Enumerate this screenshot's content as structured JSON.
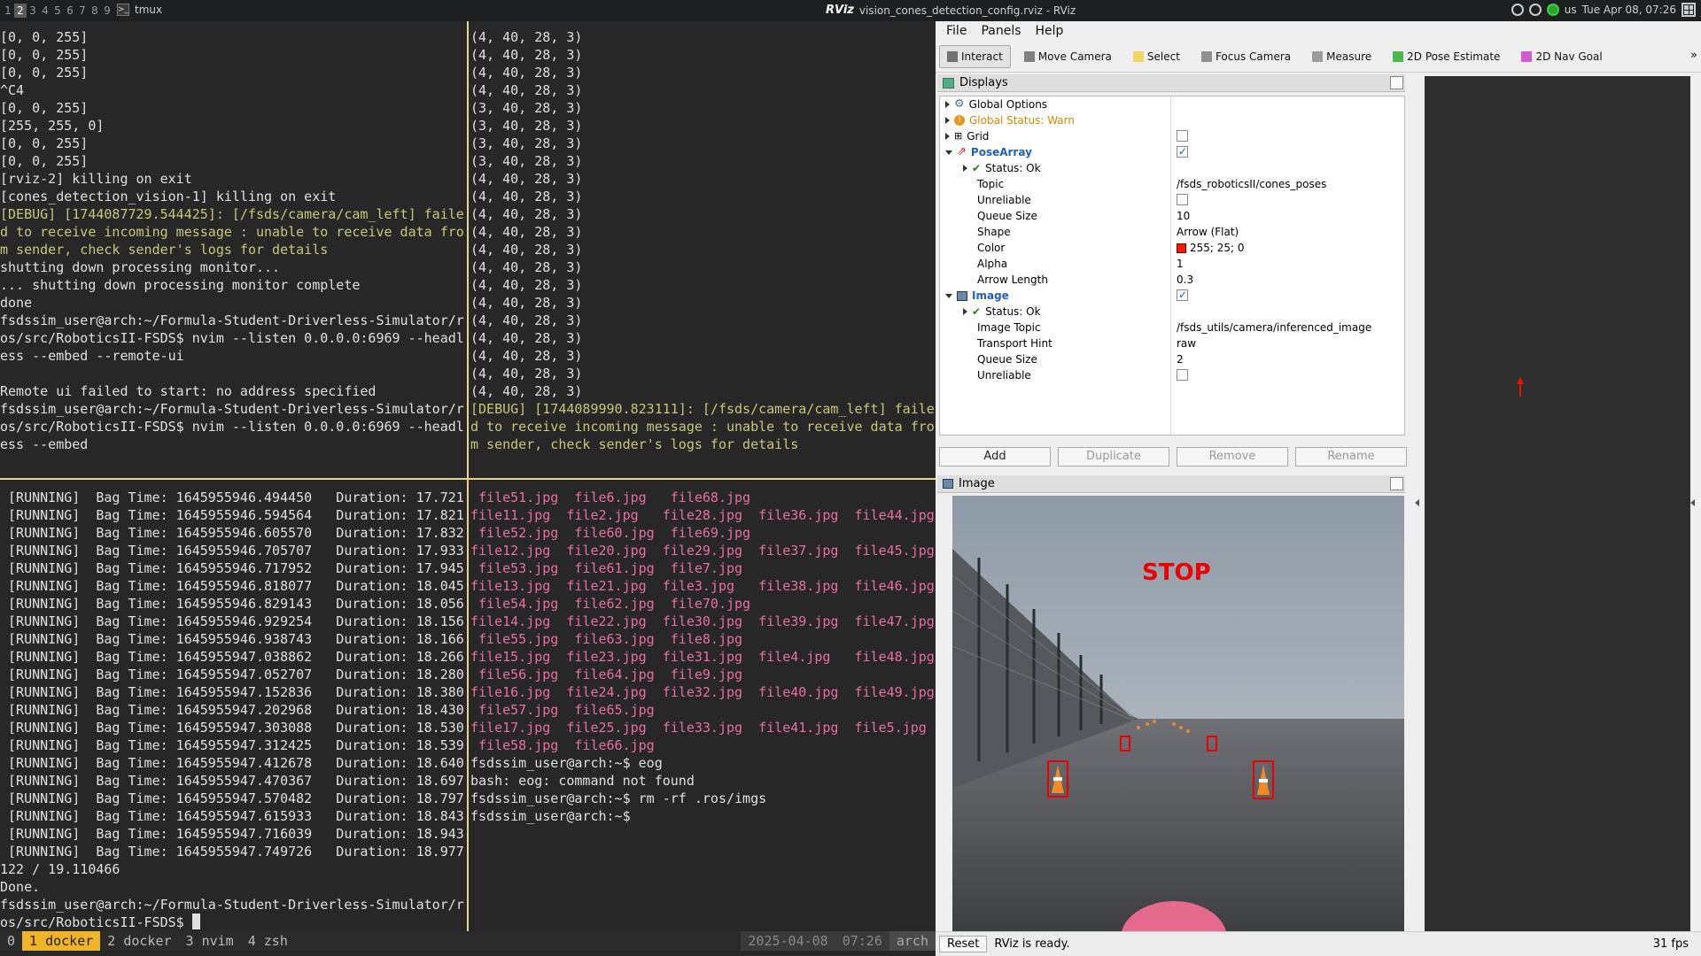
{
  "topbar": {
    "workspaces": [
      "1",
      "2",
      "3",
      "4",
      "5",
      "6",
      "7",
      "8",
      "9"
    ],
    "active_workspace": "2",
    "tmux_title": "tmux",
    "rviz_logo": "RViz",
    "rviz_title": "vision_cones_detection_config.rviz - RViz",
    "keyboard": "us",
    "clock": "Tue Apr 08, 07:26"
  },
  "pane_top_left": {
    "lines": [
      {
        "t": "[0, 0, 255]",
        "c": ""
      },
      {
        "t": "[0, 0, 255]",
        "c": ""
      },
      {
        "t": "[0, 0, 255]",
        "c": ""
      },
      {
        "t": "^C4",
        "c": ""
      },
      {
        "t": "[0, 0, 255]",
        "c": ""
      },
      {
        "t": "[255, 255, 0]",
        "c": ""
      },
      {
        "t": "[0, 0, 255]",
        "c": ""
      },
      {
        "t": "[0, 0, 255]",
        "c": ""
      },
      {
        "t": "[rviz-2] killing on exit",
        "c": ""
      },
      {
        "t": "[cones_detection_vision-1] killing on exit",
        "c": ""
      },
      {
        "t": "[DEBUG] [1744087729.544425]: [/fsds/camera/cam_left] faile",
        "c": "dbg"
      },
      {
        "t": "d to receive incoming message : unable to receive data fro",
        "c": "dbg"
      },
      {
        "t": "m sender, check sender's logs for details",
        "c": "dbg"
      },
      {
        "t": "shutting down processing monitor...",
        "c": ""
      },
      {
        "t": "... shutting down processing monitor complete",
        "c": ""
      },
      {
        "t": "done",
        "c": ""
      },
      {
        "t": "fsdssim_user@arch:~/Formula-Student-Driverless-Simulator/r",
        "c": ""
      },
      {
        "t": "os/src/RoboticsII-FSDS$ nvim --listen 0.0.0.0:6969 --headl",
        "c": ""
      },
      {
        "t": "ess --embed --remote-ui",
        "c": ""
      },
      {
        "t": "",
        "c": ""
      },
      {
        "t": "Remote ui failed to start: no address specified",
        "c": ""
      },
      {
        "t": "fsdssim_user@arch:~/Formula-Student-Driverless-Simulator/r",
        "c": ""
      },
      {
        "t": "os/src/RoboticsII-FSDS$ nvim --listen 0.0.0.0:6969 --headl",
        "c": ""
      },
      {
        "t": "ess --embed",
        "c": ""
      }
    ]
  },
  "pane_top_right": {
    "lines": [
      {
        "t": "(4, 40, 28, 3)",
        "c": ""
      },
      {
        "t": "(4, 40, 28, 3)",
        "c": ""
      },
      {
        "t": "(4, 40, 28, 3)",
        "c": ""
      },
      {
        "t": "(4, 40, 28, 3)",
        "c": ""
      },
      {
        "t": "(3, 40, 28, 3)",
        "c": ""
      },
      {
        "t": "(3, 40, 28, 3)",
        "c": ""
      },
      {
        "t": "(3, 40, 28, 3)",
        "c": ""
      },
      {
        "t": "(3, 40, 28, 3)",
        "c": ""
      },
      {
        "t": "(4, 40, 28, 3)",
        "c": ""
      },
      {
        "t": "(4, 40, 28, 3)",
        "c": ""
      },
      {
        "t": "(4, 40, 28, 3)",
        "c": ""
      },
      {
        "t": "(4, 40, 28, 3)",
        "c": ""
      },
      {
        "t": "(4, 40, 28, 3)",
        "c": ""
      },
      {
        "t": "(4, 40, 28, 3)",
        "c": ""
      },
      {
        "t": "(4, 40, 28, 3)",
        "c": ""
      },
      {
        "t": "(4, 40, 28, 3)",
        "c": ""
      },
      {
        "t": "(4, 40, 28, 3)",
        "c": ""
      },
      {
        "t": "(4, 40, 28, 3)",
        "c": ""
      },
      {
        "t": "(4, 40, 28, 3)",
        "c": ""
      },
      {
        "t": "(4, 40, 28, 3)",
        "c": ""
      },
      {
        "t": "(4, 40, 28, 3)",
        "c": ""
      },
      {
        "t": "[DEBUG] [1744089990.823111]: [/fsds/camera/cam_left] faile",
        "c": "dbg"
      },
      {
        "t": "d to receive incoming message : unable to receive data fro",
        "c": "dbg"
      },
      {
        "t": "m sender, check sender's logs for details",
        "c": "dbg"
      }
    ]
  },
  "pane_bottom_left": {
    "lines": [
      {
        "t": " [RUNNING]  Bag Time: 1645955946.494450   Duration: 17.721",
        "c": ""
      },
      {
        "t": " [RUNNING]  Bag Time: 1645955946.594564   Duration: 17.821",
        "c": ""
      },
      {
        "t": " [RUNNING]  Bag Time: 1645955946.605570   Duration: 17.832",
        "c": ""
      },
      {
        "t": " [RUNNING]  Bag Time: 1645955946.705707   Duration: 17.933",
        "c": ""
      },
      {
        "t": " [RUNNING]  Bag Time: 1645955946.717952   Duration: 17.945",
        "c": ""
      },
      {
        "t": " [RUNNING]  Bag Time: 1645955946.818077   Duration: 18.045",
        "c": ""
      },
      {
        "t": " [RUNNING]  Bag Time: 1645955946.829143   Duration: 18.056",
        "c": ""
      },
      {
        "t": " [RUNNING]  Bag Time: 1645955946.929254   Duration: 18.156",
        "c": ""
      },
      {
        "t": " [RUNNING]  Bag Time: 1645955946.938743   Duration: 18.166",
        "c": ""
      },
      {
        "t": " [RUNNING]  Bag Time: 1645955947.038862   Duration: 18.266",
        "c": ""
      },
      {
        "t": " [RUNNING]  Bag Time: 1645955947.052707   Duration: 18.280",
        "c": ""
      },
      {
        "t": " [RUNNING]  Bag Time: 1645955947.152836   Duration: 18.380",
        "c": ""
      },
      {
        "t": " [RUNNING]  Bag Time: 1645955947.202968   Duration: 18.430",
        "c": ""
      },
      {
        "t": " [RUNNING]  Bag Time: 1645955947.303088   Duration: 18.530",
        "c": ""
      },
      {
        "t": " [RUNNING]  Bag Time: 1645955947.312425   Duration: 18.539",
        "c": ""
      },
      {
        "t": " [RUNNING]  Bag Time: 1645955947.412678   Duration: 18.640",
        "c": ""
      },
      {
        "t": " [RUNNING]  Bag Time: 1645955947.470367   Duration: 18.697",
        "c": ""
      },
      {
        "t": " [RUNNING]  Bag Time: 1645955947.570482   Duration: 18.797",
        "c": ""
      },
      {
        "t": " [RUNNING]  Bag Time: 1645955947.615933   Duration: 18.843",
        "c": ""
      },
      {
        "t": " [RUNNING]  Bag Time: 1645955947.716039   Duration: 18.943",
        "c": ""
      },
      {
        "t": " [RUNNING]  Bag Time: 1645955947.749726   Duration: 18.977",
        "c": ""
      },
      {
        "t": "122 / 19.110466",
        "c": ""
      },
      {
        "t": "Done.",
        "c": ""
      },
      {
        "t": "fsdssim_user@arch:~/Formula-Student-Driverless-Simulator/r",
        "c": ""
      },
      {
        "t": "os/src/RoboticsII-FSDS$ ",
        "c": "",
        "cursor": true
      }
    ]
  },
  "pane_bottom_right": {
    "lines": [
      {
        "t": " file51.jpg  file6.jpg   file68.jpg",
        "c": "pink"
      },
      {
        "t": "file11.jpg  file2.jpg   file28.jpg  file36.jpg  file44.jpg",
        "c": "pink"
      },
      {
        "t": " file52.jpg  file60.jpg  file69.jpg",
        "c": "pink"
      },
      {
        "t": "file12.jpg  file20.jpg  file29.jpg  file37.jpg  file45.jpg",
        "c": "pink"
      },
      {
        "t": " file53.jpg  file61.jpg  file7.jpg",
        "c": "pink"
      },
      {
        "t": "file13.jpg  file21.jpg  file3.jpg   file38.jpg  file46.jpg",
        "c": "pink"
      },
      {
        "t": " file54.jpg  file62.jpg  file70.jpg",
        "c": "pink"
      },
      {
        "t": "file14.jpg  file22.jpg  file30.jpg  file39.jpg  file47.jpg",
        "c": "pink"
      },
      {
        "t": " file55.jpg  file63.jpg  file8.jpg",
        "c": "pink"
      },
      {
        "t": "file15.jpg  file23.jpg  file31.jpg  file4.jpg   file48.jpg",
        "c": "pink"
      },
      {
        "t": " file56.jpg  file64.jpg  file9.jpg",
        "c": "pink"
      },
      {
        "t": "file16.jpg  file24.jpg  file32.jpg  file40.jpg  file49.jpg",
        "c": "pink"
      },
      {
        "t": " file57.jpg  file65.jpg",
        "c": "pink"
      },
      {
        "t": "file17.jpg  file25.jpg  file33.jpg  file41.jpg  file5.jpg",
        "c": "pink"
      },
      {
        "t": " file58.jpg  file66.jpg",
        "c": "pink"
      },
      {
        "t": "fsdssim_user@arch:~$ eog",
        "c": ""
      },
      {
        "t": "bash: eog: command not found",
        "c": ""
      },
      {
        "t": "fsdssim_user@arch:~$ rm -rf .ros/imgs",
        "c": ""
      },
      {
        "t": "fsdssim_user@arch:~$ ",
        "c": ""
      }
    ]
  },
  "tmux_status": {
    "session": "0",
    "windows": [
      {
        "num": "1",
        "name": "docker",
        "active": true
      },
      {
        "num": "2",
        "name": "docker",
        "active": false
      },
      {
        "num": "3",
        "name": "nvim",
        "active": false
      },
      {
        "num": "4",
        "name": "zsh",
        "active": false
      }
    ],
    "date": "2025-04-08",
    "time": "07:26",
    "host": "arch"
  },
  "rviz": {
    "menu": [
      "File",
      "Panels",
      "Help"
    ],
    "toolbar": [
      {
        "label": "Interact",
        "icon": "cursor-icon",
        "active": true
      },
      {
        "label": "Move Camera",
        "icon": "move-camera-icon",
        "active": false
      },
      {
        "label": "Select",
        "icon": "select-icon",
        "active": false
      },
      {
        "label": "Focus Camera",
        "icon": "focus-camera-icon",
        "active": false
      },
      {
        "label": "Measure",
        "icon": "measure-icon",
        "active": false
      },
      {
        "label": "2D Pose Estimate",
        "icon": "pose-estimate-icon",
        "active": false
      },
      {
        "label": "2D Nav Goal",
        "icon": "nav-goal-icon",
        "active": false
      }
    ],
    "toolbar_more": "»",
    "displays_title": "Displays",
    "displays": {
      "global_options": "Global Options",
      "global_status": "Global Status: Warn",
      "grid": "Grid",
      "posearray": "PoseArray",
      "posearray_status": "Status: Ok",
      "topic_label": "Topic",
      "topic_value": "/fsds_roboticsII/cones_poses",
      "unreliable_label": "Unreliable",
      "queue_label": "Queue Size",
      "queue_value": "10",
      "shape_label": "Shape",
      "shape_value": "Arrow (Flat)",
      "color_label": "Color",
      "color_value": "255; 25; 0",
      "color_swatch": "#ff1900",
      "alpha_label": "Alpha",
      "alpha_value": "1",
      "arrow_len_label": "Arrow Length",
      "arrow_len_value": "0.3",
      "image": "Image",
      "image_status": "Status: Ok",
      "image_topic_label": "Image Topic",
      "image_topic_value": "/fsds_utils/camera/inferenced_image",
      "transport_label": "Transport Hint",
      "transport_value": "raw",
      "image_queue_label": "Queue Size",
      "image_queue_value": "2",
      "image_unreliable_label": "Unreliable"
    },
    "buttons": [
      "Add",
      "Duplicate",
      "Remove",
      "Rename"
    ],
    "image_panel_title": "Image",
    "image_overlay_text": "STOP",
    "reset": "Reset",
    "status": "RViz is ready.",
    "fps": "31 fps"
  }
}
